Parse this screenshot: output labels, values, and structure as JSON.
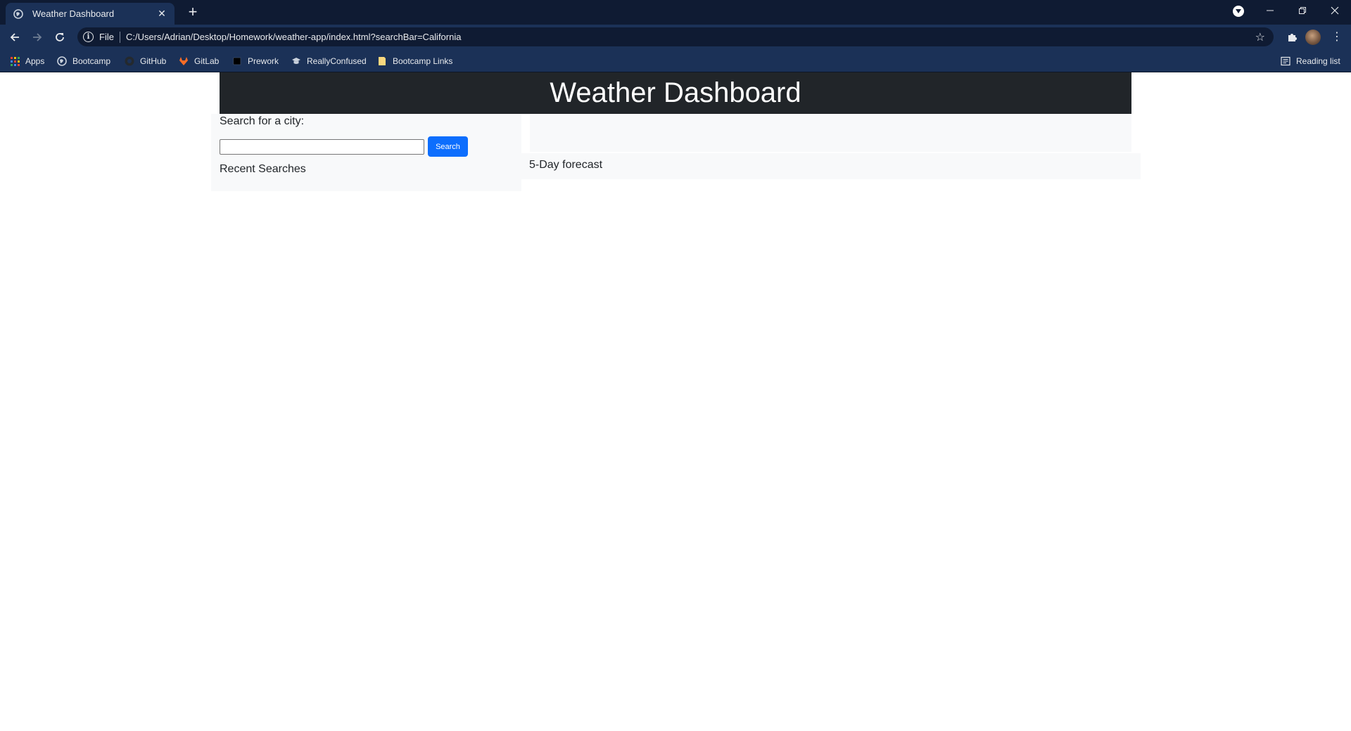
{
  "browser": {
    "tab": {
      "title": "Weather Dashboard",
      "close": "✕"
    },
    "new_tab": "+",
    "window_controls": {
      "minimize": "minimize-icon",
      "restore": "restore-icon",
      "close": "close-icon"
    },
    "nav": {
      "back": "back-arrow-icon",
      "forward": "forward-arrow-icon",
      "reload": "reload-icon"
    },
    "omnibox": {
      "scheme_label": "File",
      "url": "C:/Users/Adrian/Desktop/Homework/weather-app/index.html?searchBar=California"
    },
    "bookmarks": [
      {
        "label": "Apps",
        "icon": "apps-grid-icon"
      },
      {
        "label": "Bootcamp",
        "icon": "globe-icon"
      },
      {
        "label": "GitHub",
        "icon": "github-icon"
      },
      {
        "label": "GitLab",
        "icon": "gitlab-icon"
      },
      {
        "label": "Prework",
        "icon": "book-icon"
      },
      {
        "label": "ReallyConfused",
        "icon": "graduation-cap-icon"
      },
      {
        "label": "Bootcamp Links",
        "icon": "folder-icon"
      }
    ],
    "reading_list": "Reading list",
    "colors": {
      "frame": "#0f1b33",
      "toolbar": "#1b3157"
    }
  },
  "page": {
    "header": {
      "title": "Weather Dashboard"
    },
    "sidebar": {
      "search_label": "Search for a city:",
      "input_value": "",
      "search_button": "Search",
      "recent_label": "Recent Searches"
    },
    "forecast": {
      "label": "5-Day forecast"
    },
    "colors": {
      "header_bg": "#212529",
      "panel_bg": "#f8f9fa",
      "button_bg": "#0d6efd"
    }
  }
}
